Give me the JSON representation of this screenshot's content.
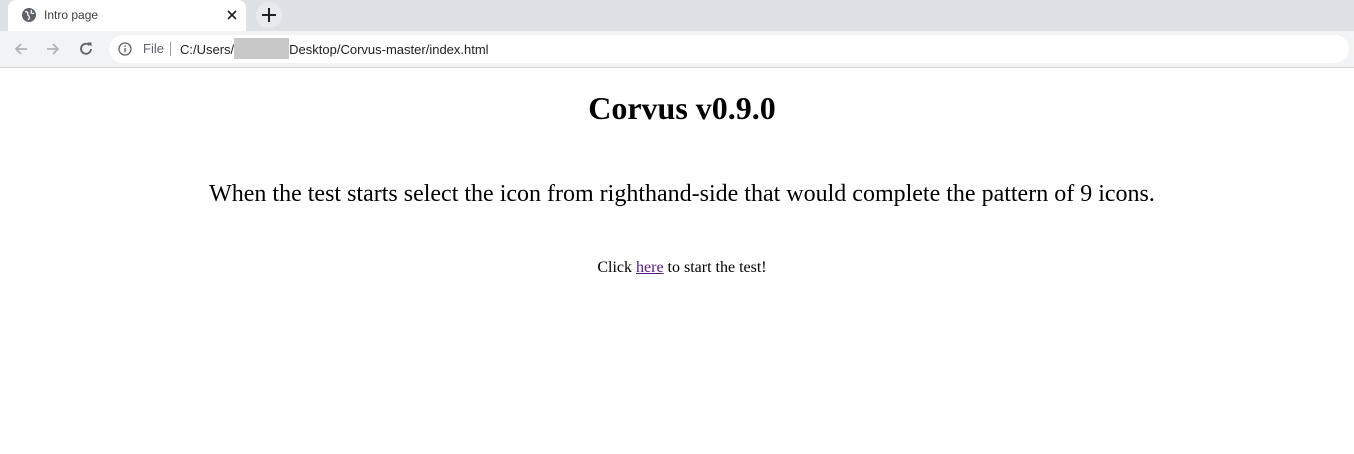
{
  "browser": {
    "tab": {
      "title": "Intro page",
      "favicon": "globe-icon",
      "close_icon": "close-icon"
    },
    "new_tab_icon": "plus-icon",
    "toolbar": {
      "back_icon": "arrow-left-icon",
      "forward_icon": "arrow-right-icon",
      "reload_icon": "reload-icon",
      "info_icon": "info-icon",
      "scheme_label": "File",
      "url_prefix": "C:/Users/",
      "url_suffix": "Desktop/Corvus-master/index.html"
    }
  },
  "page": {
    "title": "Corvus v0.9.0",
    "instructions": "When the test starts select the icon from righthand-side that would complete the pattern of 9 icons.",
    "start_prefix": "Click",
    "start_link": "here",
    "start_suffix": "to start the test!"
  },
  "colors": {
    "link_visited": "#551a8b",
    "tabstrip_bg": "#dee1e6",
    "toolbar_bg": "#f1f3f4"
  }
}
